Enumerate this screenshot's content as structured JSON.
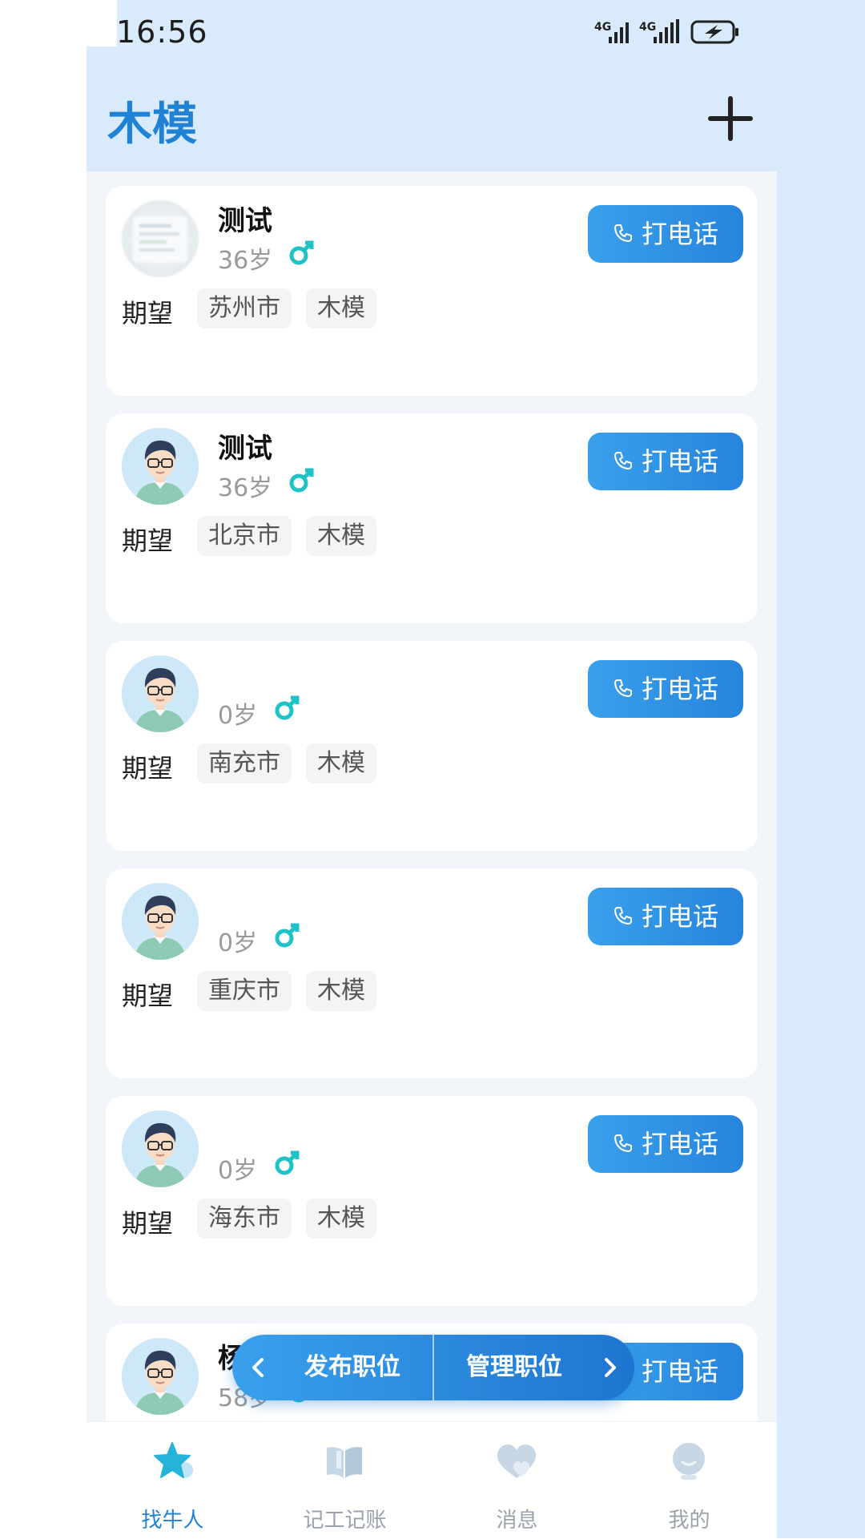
{
  "status_bar": {
    "time": "16:56",
    "signal_1": "4G",
    "signal_2": "4G"
  },
  "header": {
    "title": "木模"
  },
  "list": {
    "expect_label": "期望",
    "call_label": "打电话",
    "age_suffix": "岁",
    "items": [
      {
        "name": "测试",
        "age": "36岁",
        "city": "苏州市",
        "job": "木模"
      },
      {
        "name": "测试",
        "age": "36岁",
        "city": "北京市",
        "job": "木模"
      },
      {
        "name": "",
        "age": "0岁",
        "city": "南充市",
        "job": "木模"
      },
      {
        "name": "",
        "age": "0岁",
        "city": "重庆市",
        "job": "木模"
      },
      {
        "name": "",
        "age": "0岁",
        "city": "海东市",
        "job": "木模"
      },
      {
        "name": "杨",
        "age": "58岁",
        "city": "",
        "job": ""
      }
    ]
  },
  "floating": {
    "publish": "发布职位",
    "manage": "管理职位"
  },
  "tabs": [
    {
      "label": "找牛人",
      "icon": "star-icon"
    },
    {
      "label": "记工记账",
      "icon": "book-icon"
    },
    {
      "label": "消息",
      "icon": "message-heart-icon"
    },
    {
      "label": "我的",
      "icon": "profile-icon"
    }
  ],
  "colors": {
    "accent": "#1f82d4",
    "header_bg": "#d8eafc",
    "gender_male": "#1ec3c8"
  }
}
